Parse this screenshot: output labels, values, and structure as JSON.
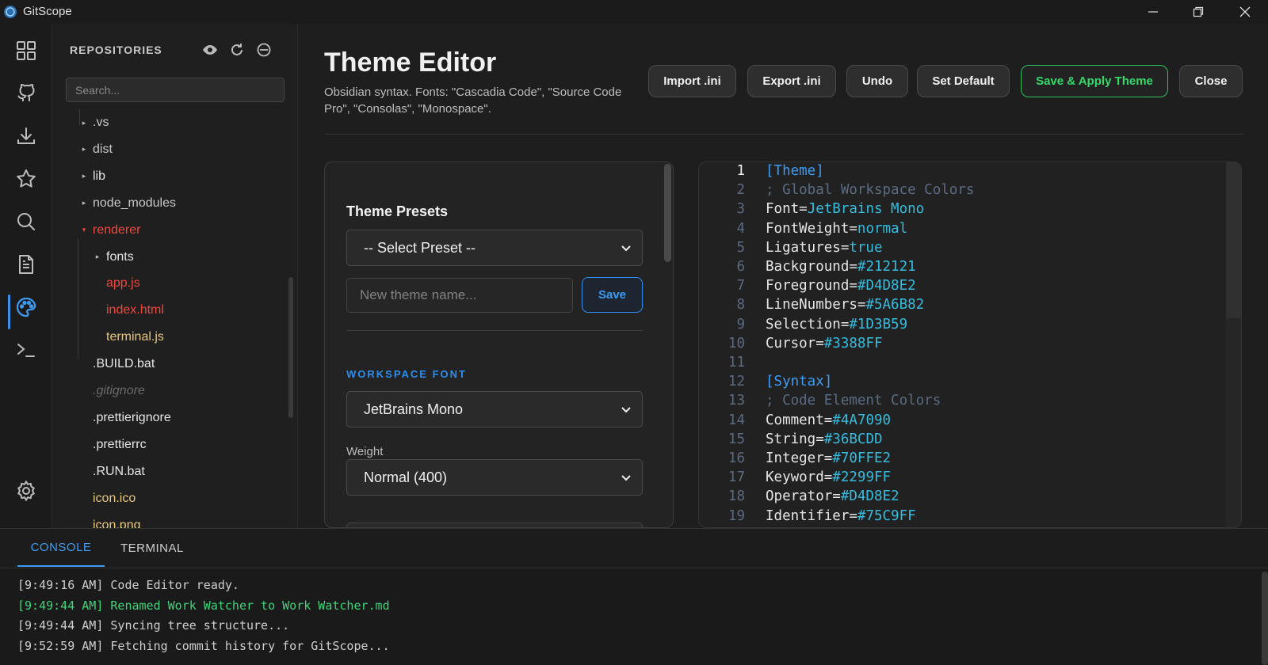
{
  "app": {
    "title": "GitScope"
  },
  "sidebar": {
    "title": "REPOSITORIES",
    "search_placeholder": "Search...",
    "tree": [
      {
        "label": ".vs",
        "type": "folder",
        "color": "#c8c8c8"
      },
      {
        "label": "dist",
        "type": "folder",
        "color": "#c8c8c8"
      },
      {
        "label": "lib",
        "type": "folder",
        "color": "#e6e6e6"
      },
      {
        "label": "node_modules",
        "type": "folder",
        "color": "#c8c8c8"
      },
      {
        "label": "renderer",
        "type": "folder-open",
        "color": "#f0473d"
      },
      {
        "label": "fonts",
        "type": "folder",
        "color": "#e6e6e6"
      },
      {
        "label": "app.js",
        "type": "file",
        "color": "#f0473d"
      },
      {
        "label": "index.html",
        "type": "file",
        "color": "#f0473d"
      },
      {
        "label": "terminal.js",
        "type": "file",
        "color": "#e8c77a"
      },
      {
        "label": ".BUILD.bat",
        "type": "file",
        "color": "#e6e6e6"
      },
      {
        "label": ".gitignore",
        "type": "file",
        "color": "#6a6a6a"
      },
      {
        "label": ".prettierignore",
        "type": "file",
        "color": "#e6e6e6"
      },
      {
        "label": ".prettierrc",
        "type": "file",
        "color": "#e6e6e6"
      },
      {
        "label": ".RUN.bat",
        "type": "file",
        "color": "#e6e6e6"
      },
      {
        "label": "icon.ico",
        "type": "file",
        "color": "#e8c77a"
      },
      {
        "label": "icon.png",
        "type": "file",
        "color": "#e8c77a"
      }
    ]
  },
  "header": {
    "title": "Theme Editor",
    "subtitle": "Obsidian syntax. Fonts: \"Cascadia Code\", \"Source Code Pro\", \"Consolas\", \"Monospace\".",
    "buttons": {
      "import": "Import .ini",
      "export": "Export .ini",
      "undo": "Undo",
      "set_default": "Set Default",
      "save_apply": "Save & Apply Theme",
      "close": "Close"
    }
  },
  "panel": {
    "presets_heading": "Theme Presets",
    "preset_select": "-- Select Preset --",
    "new_theme_placeholder": "New theme name...",
    "save_label": "Save",
    "workspace_font_heading": "WORKSPACE FONT",
    "font_select": "JetBrains Mono",
    "weight_label": "Weight",
    "weight_select": "Normal (400)"
  },
  "editor": {
    "current_line": 1,
    "lines": [
      {
        "n": "1",
        "parts": [
          [
            "[Theme]",
            "#3d9cf5"
          ]
        ]
      },
      {
        "n": "2",
        "parts": [
          [
            "; Global Workspace Colors",
            "#5A6B82"
          ]
        ]
      },
      {
        "n": "3",
        "parts": [
          [
            "Font=",
            "#e6e6e6"
          ],
          [
            "JetBrains Mono",
            "#36BCDD"
          ]
        ]
      },
      {
        "n": "4",
        "parts": [
          [
            "FontWeight=",
            "#e6e6e6"
          ],
          [
            "normal",
            "#36BCDD"
          ]
        ]
      },
      {
        "n": "5",
        "parts": [
          [
            "Ligatures=",
            "#e6e6e6"
          ],
          [
            "true",
            "#36BCDD"
          ]
        ]
      },
      {
        "n": "6",
        "parts": [
          [
            "Background=",
            "#e6e6e6"
          ],
          [
            "#212121",
            "#36BCDD"
          ]
        ]
      },
      {
        "n": "7",
        "parts": [
          [
            "Foreground=",
            "#e6e6e6"
          ],
          [
            "#D4D8E2",
            "#36BCDD"
          ]
        ]
      },
      {
        "n": "8",
        "parts": [
          [
            "LineNumbers=",
            "#e6e6e6"
          ],
          [
            "#5A6B82",
            "#36BCDD"
          ]
        ]
      },
      {
        "n": "9",
        "parts": [
          [
            "Selection=",
            "#e6e6e6"
          ],
          [
            "#1D3B59",
            "#36BCDD"
          ]
        ]
      },
      {
        "n": "10",
        "parts": [
          [
            "Cursor=",
            "#e6e6e6"
          ],
          [
            "#3388FF",
            "#36BCDD"
          ]
        ]
      },
      {
        "n": "11",
        "parts": []
      },
      {
        "n": "12",
        "parts": [
          [
            "[Syntax]",
            "#3d9cf5"
          ]
        ]
      },
      {
        "n": "13",
        "parts": [
          [
            "; Code Element Colors",
            "#5A6B82"
          ]
        ]
      },
      {
        "n": "14",
        "parts": [
          [
            "Comment=",
            "#e6e6e6"
          ],
          [
            "#4A7090",
            "#36BCDD"
          ]
        ]
      },
      {
        "n": "15",
        "parts": [
          [
            "String=",
            "#e6e6e6"
          ],
          [
            "#36BCDD",
            "#36BCDD"
          ]
        ]
      },
      {
        "n": "16",
        "parts": [
          [
            "Integer=",
            "#e6e6e6"
          ],
          [
            "#70FFE2",
            "#36BCDD"
          ]
        ]
      },
      {
        "n": "17",
        "parts": [
          [
            "Keyword=",
            "#e6e6e6"
          ],
          [
            "#2299FF",
            "#36BCDD"
          ]
        ]
      },
      {
        "n": "18",
        "parts": [
          [
            "Operator=",
            "#e6e6e6"
          ],
          [
            "#D4D8E2",
            "#36BCDD"
          ]
        ]
      },
      {
        "n": "19",
        "parts": [
          [
            "Identifier=",
            "#e6e6e6"
          ],
          [
            "#75C9FF",
            "#36BCDD"
          ]
        ]
      }
    ]
  },
  "bottom_panel": {
    "tabs": {
      "console": "CONSOLE",
      "terminal": "TERMINAL"
    },
    "logs": [
      {
        "text": "[9:49:16 AM] Code Editor ready.",
        "color": "#cfcfcf"
      },
      {
        "text": "[9:49:44 AM] Renamed Work Watcher to Work Watcher.md",
        "color": "#3fd47a"
      },
      {
        "text": "[9:49:44 AM] Syncing tree structure...",
        "color": "#cfcfcf"
      },
      {
        "text": "[9:52:59 AM] Fetching commit history for GitScope...",
        "color": "#cfcfcf"
      }
    ]
  },
  "icons": {
    "activity": [
      "dashboard-icon",
      "github-icon",
      "download-icon",
      "star-icon",
      "search-icon",
      "document-icon",
      "palette-icon",
      "terminal-icon",
      "settings-icon"
    ],
    "sidebar": [
      "eye-icon",
      "refresh-icon",
      "collapse-icon"
    ],
    "window": [
      "minimize-icon",
      "restore-icon",
      "close-icon"
    ]
  },
  "colors": {
    "accent": "#3d9cf5",
    "success": "#35d96a",
    "error": "#f0473d"
  }
}
